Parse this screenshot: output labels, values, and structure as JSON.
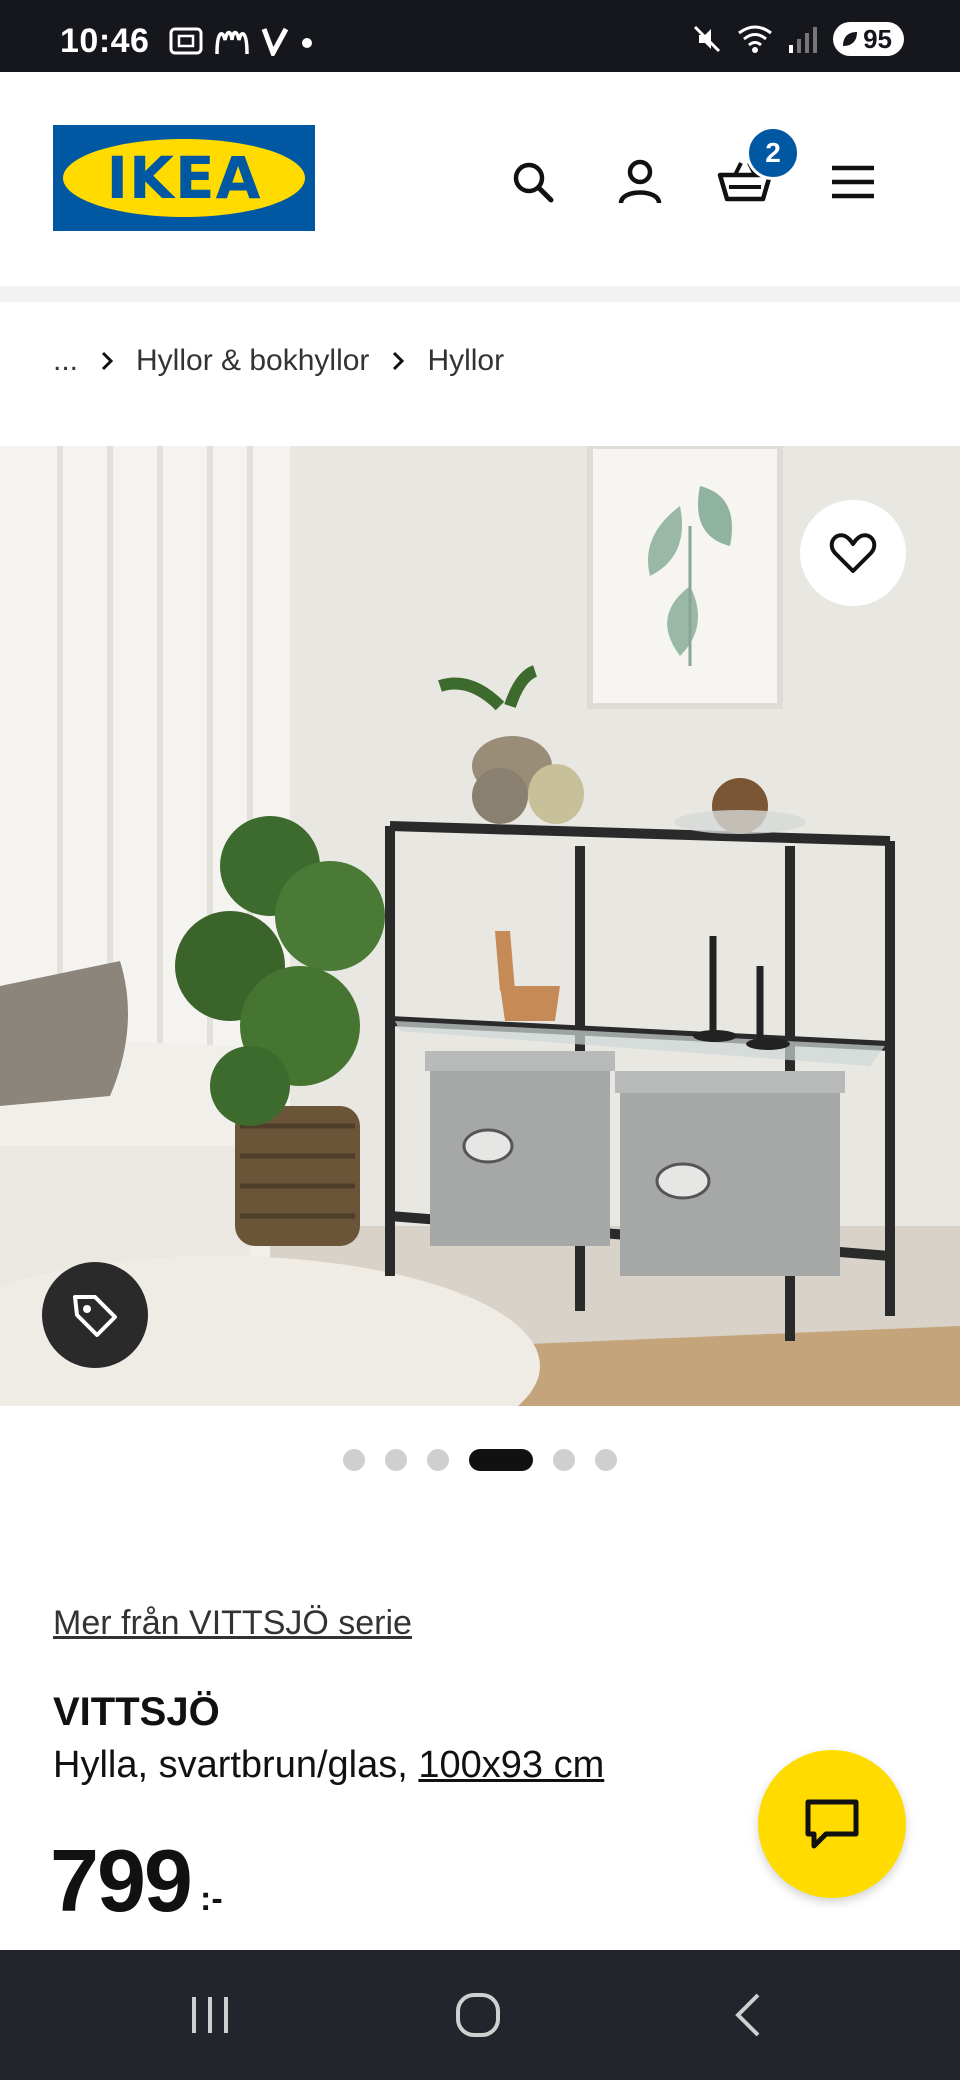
{
  "status_bar": {
    "time": "10:46",
    "battery": "95",
    "icons": [
      "screenshot-icon",
      "mcdonalds-icon",
      "v-app-icon",
      "dot-icon",
      "mute-icon",
      "wifi-icon",
      "signal-icon",
      "battery-icon"
    ]
  },
  "header": {
    "logo_text": "IKEA",
    "cart_count": "2",
    "icons": [
      "search-icon",
      "user-icon",
      "cart-icon",
      "menu-icon"
    ]
  },
  "breadcrumb": {
    "items": [
      "...",
      "Hyllor & bokhyllor",
      "Hyllor"
    ]
  },
  "gallery": {
    "dots_total": 6,
    "active_index": 3
  },
  "product": {
    "series_link": "Mer från VITTSJÖ serie",
    "name": "VITTSJÖ",
    "description": "Hylla, svartbrun/glas, ",
    "size_link": "100x93 cm",
    "price": "799",
    "price_suffix": ":-"
  },
  "colors": {
    "ikea_blue": "#0058a3",
    "ikea_yellow": "#ffdb00",
    "status_bar_bg": "#15171c",
    "nav_bar_bg": "#22252c"
  }
}
